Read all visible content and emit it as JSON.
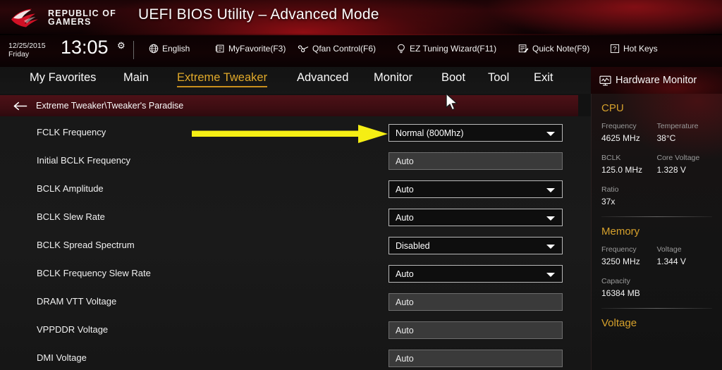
{
  "banner": {
    "logo_line1": "REPUBLIC OF",
    "logo_line2": "GAMERS",
    "title": "UEFI BIOS Utility – Advanced Mode"
  },
  "toolbar": {
    "date": "12/25/2015",
    "weekday": "Friday",
    "time": "13:05",
    "items": [
      {
        "label": "English",
        "icon": "globe-icon"
      },
      {
        "label": "MyFavorite(F3)",
        "icon": "favorite-icon"
      },
      {
        "label": "Qfan Control(F6)",
        "icon": "fan-icon"
      },
      {
        "label": "EZ Tuning Wizard(F11)",
        "icon": "bulb-icon"
      },
      {
        "label": "Quick Note(F9)",
        "icon": "note-icon"
      },
      {
        "label": "Hot Keys",
        "icon": "question-icon"
      }
    ]
  },
  "nav": {
    "tabs": [
      {
        "label": "My Favorites",
        "active": false
      },
      {
        "label": "Main",
        "active": false
      },
      {
        "label": "Extreme Tweaker",
        "active": true
      },
      {
        "label": "Advanced",
        "active": false
      },
      {
        "label": "Monitor",
        "active": false
      },
      {
        "label": "Boot",
        "active": false
      },
      {
        "label": "Tool",
        "active": false
      },
      {
        "label": "Exit",
        "active": false
      }
    ],
    "hardware_monitor_label": "Hardware Monitor",
    "accent_color": "#e0a92a"
  },
  "breadcrumb": {
    "back_icon": "back-arrow-icon",
    "path": "Extreme Tweaker\\Tweaker's Paradise"
  },
  "settings": {
    "rows": [
      {
        "label": "FCLK Frequency",
        "value": "Normal (800Mhz)",
        "type": "select",
        "highlighted": true
      },
      {
        "label": "Initial BCLK Frequency",
        "value": "Auto",
        "type": "input",
        "highlighted": false
      },
      {
        "label": "BCLK Amplitude",
        "value": "Auto",
        "type": "select",
        "highlighted": false
      },
      {
        "label": "BCLK Slew Rate",
        "value": "Auto",
        "type": "select",
        "highlighted": false
      },
      {
        "label": "BCLK Spread Spectrum",
        "value": "Disabled",
        "type": "select",
        "highlighted": false
      },
      {
        "label": "BCLK Frequency Slew Rate",
        "value": "Auto",
        "type": "select",
        "highlighted": false
      },
      {
        "label": "DRAM VTT Voltage",
        "value": "Auto",
        "type": "input",
        "highlighted": false
      },
      {
        "label": "VPPDDR Voltage",
        "value": "Auto",
        "type": "input",
        "highlighted": false
      },
      {
        "label": "DMI Voltage",
        "value": "Auto",
        "type": "input",
        "highlighted": false
      }
    ]
  },
  "annotation": {
    "type": "arrow",
    "color": "#f5ee14",
    "points_to": "FCLK Frequency value field"
  },
  "hardware_monitor": {
    "sections": [
      {
        "title": "CPU",
        "blocks": [
          [
            {
              "key": "Frequency",
              "value": "4625 MHz"
            },
            {
              "key": "Temperature",
              "value": "38°C"
            }
          ],
          [
            {
              "key": "BCLK",
              "value": "125.0 MHz"
            },
            {
              "key": "Core Voltage",
              "value": "1.328 V"
            }
          ],
          [
            {
              "key": "Ratio",
              "value": "37x"
            }
          ]
        ]
      },
      {
        "title": "Memory",
        "blocks": [
          [
            {
              "key": "Frequency",
              "value": "3250 MHz"
            },
            {
              "key": "Voltage",
              "value": "1.344 V"
            }
          ],
          [
            {
              "key": "Capacity",
              "value": "16384 MB"
            }
          ]
        ]
      },
      {
        "title": "Voltage",
        "blocks": []
      }
    ],
    "title_color": "#d6a12c"
  }
}
